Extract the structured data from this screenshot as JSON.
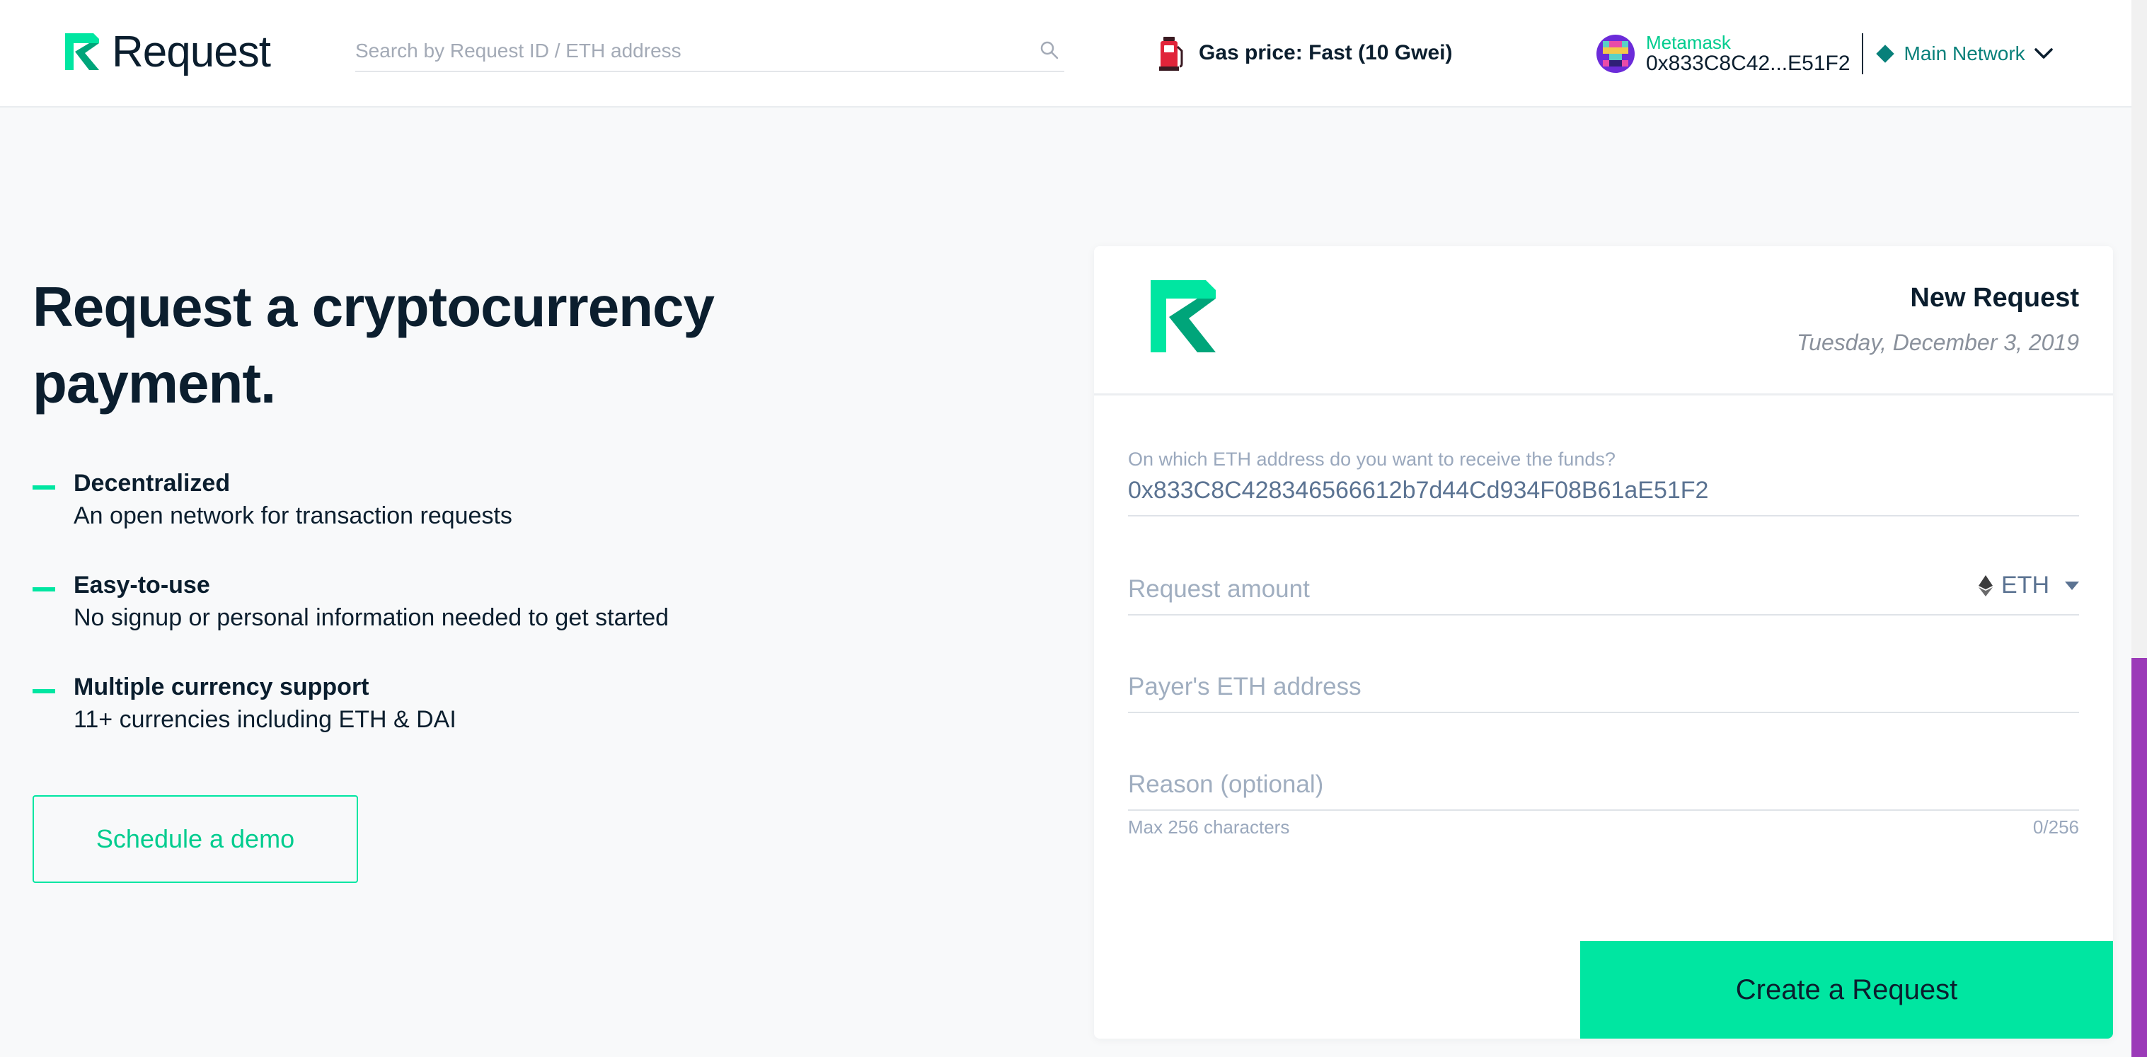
{
  "header": {
    "brand": "Request",
    "search_placeholder": "Search by Request ID / ETH address",
    "gas_label": "Gas price: Fast (10 Gwei)",
    "account": {
      "wallet": "Metamask",
      "address": "0x833C8C42...E51F2"
    },
    "network": "Main Network"
  },
  "hero": {
    "title": "Request a cryptocurrency payment.",
    "features": [
      {
        "title": "Decentralized",
        "description": "An open network for transaction requests"
      },
      {
        "title": "Easy-to-use",
        "description": "No signup or personal information needed to get started"
      },
      {
        "title": "Multiple currency support",
        "description": "11+ currencies including ETH & DAI"
      }
    ],
    "demo_button": "Schedule a demo"
  },
  "card": {
    "title": "New Request",
    "date": "Tuesday, December 3, 2019",
    "receive_label": "On which ETH address do you want to receive the funds?",
    "receive_address": "0x833C8C428346566612b7d44Cd934F08B61aE51F2",
    "amount_placeholder": "Request amount",
    "currency": "ETH",
    "payer_placeholder": "Payer's ETH address",
    "reason_placeholder": "Reason (optional)",
    "reason_helper": "Max 256 characters",
    "reason_counter": "0/256",
    "submit_button": "Create a Request"
  },
  "colors": {
    "accent": "#00e6a1",
    "accent_text": "#00cc8e",
    "network": "#08807a",
    "text_dark": "#0b1e2e",
    "background": "#f8f9fa",
    "scrollbar_thumb": "#9b3ab8"
  },
  "icons": {
    "brand": "request-logo-icon",
    "search": "search-icon",
    "gas": "gas-pump-icon",
    "avatar": "identicon-avatar",
    "network": "diamond-icon",
    "network_toggle": "chevron-down-icon",
    "currency": "ethereum-icon",
    "currency_toggle": "caret-down-icon"
  }
}
